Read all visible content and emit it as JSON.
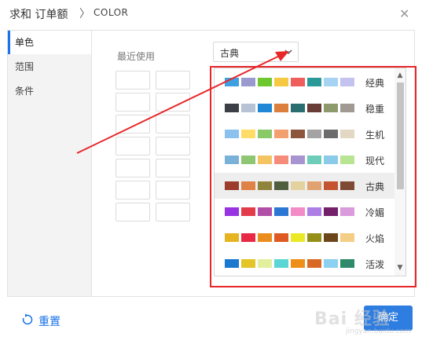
{
  "header": {
    "title": "求和 订单额",
    "separator": "〉",
    "subtitle": "COLOR",
    "close_icon": "close-icon"
  },
  "sidebar": {
    "items": [
      {
        "label": "单色",
        "active": true
      },
      {
        "label": "范围",
        "active": false
      },
      {
        "label": "条件",
        "active": false
      }
    ]
  },
  "main": {
    "recent_label": "最近使用",
    "select": {
      "value": "古典",
      "chevron_icon": "chevron-down-icon"
    },
    "palettes": [
      {
        "name": "经典",
        "colors": [
          "#3ea0e0",
          "#9a9ad0",
          "#6dc830",
          "#f5c942",
          "#ef5d5d",
          "#2a9a98",
          "#a6d3f2",
          "#c4c3ef"
        ]
      },
      {
        "name": "稳重",
        "colors": [
          "#3c4046",
          "#b6c3d4",
          "#1f87d6",
          "#dc7e3c",
          "#2a6e72",
          "#693c35",
          "#8d9a6c",
          "#a09a92"
        ]
      },
      {
        "name": "生机",
        "colors": [
          "#8ac1ee",
          "#ffdb67",
          "#8ac968",
          "#f3a070",
          "#8d553b",
          "#a4a2a2",
          "#6c6c6c",
          "#e2d8c4"
        ]
      },
      {
        "name": "现代",
        "colors": [
          "#79b1d9",
          "#8fc672",
          "#f4c463",
          "#f78b79",
          "#a894d0",
          "#6dcdb9",
          "#89cbe9",
          "#b8e593"
        ]
      },
      {
        "name": "古典",
        "colors": [
          "#9c3c2c",
          "#df8247",
          "#90833c",
          "#4e5e3f",
          "#e3d29f",
          "#e1a171",
          "#c3542e",
          "#7e4a34"
        ],
        "highlight": true
      },
      {
        "name": "冷媚",
        "colors": [
          "#9733e0",
          "#e43b4b",
          "#b14fa8",
          "#2b77d3",
          "#f28bc7",
          "#ad7ee6",
          "#731f69",
          "#d99bdc"
        ]
      },
      {
        "name": "火焰",
        "colors": [
          "#e6b420",
          "#e92845",
          "#ea8d1d",
          "#de5a22",
          "#ebe827",
          "#958f17",
          "#6d451b",
          "#f4ce84"
        ]
      },
      {
        "name": "活泼",
        "colors": [
          "#1a78cf",
          "#e4c527",
          "#e2ef9f",
          "#5cd6d5",
          "#ee8f18",
          "#d86a26",
          "#8bcff1",
          "#2f8a6c"
        ]
      }
    ],
    "scroll_up_icon": "chevron-up-icon",
    "scroll_down_icon": "chevron-down-icon"
  },
  "footer": {
    "reset_label": "重置",
    "reset_icon": "refresh-icon",
    "ok_label": "确定"
  },
  "watermark": {
    "text": "Bai 经验",
    "url_text": "jingyan.baidu.com"
  },
  "colors": {
    "accent": "#1a73e8",
    "primary_button": "#2e7de0",
    "annotation_red": "#e8272a"
  }
}
